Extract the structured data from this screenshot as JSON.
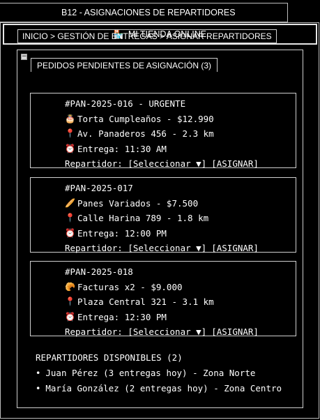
{
  "window": {
    "title": "B12 - ASIGNACIONES DE REPARTIDORES"
  },
  "store": {
    "icon": "store-icon",
    "icon_glyph": "🏪",
    "name": "MI TIENDA ONLINE"
  },
  "breadcrumb": "INICIO > GESTIÓN DE ENTREGAS > ASIGNAR REPARTIDORES",
  "pending": {
    "collapse_glyph": "−",
    "title": "PEDIDOS PENDIENTES DE ASIGNACIÓN (3)",
    "orders": [
      {
        "id_line": "#PAN-2025-016 - URGENTE",
        "item_icon": "🎂",
        "item": "Torta Cumpleaños - $12.990",
        "address_icon": "📍",
        "address": "Av. Panaderos 456 - 2.3 km",
        "time_icon": "⏰",
        "delivery": "Entrega: 11:30 AM",
        "courier_label": "Repartidor:",
        "select_label": "[Seleccionar ▼]",
        "assign_label": "[ASIGNAR]"
      },
      {
        "id_line": "#PAN-2025-017",
        "item_icon": "🥖",
        "item": "Panes Variados - $7.500",
        "address_icon": "📍",
        "address": "Calle Harina 789 - 1.8 km",
        "time_icon": "⏰",
        "delivery": "Entrega: 12:00 PM",
        "courier_label": "Repartidor:",
        "select_label": "[Seleccionar ▼]",
        "assign_label": "[ASIGNAR]"
      },
      {
        "id_line": "#PAN-2025-018",
        "item_icon": "🥐",
        "item": "Facturas x2 - $9.000",
        "address_icon": "📍",
        "address": "Plaza Central 321 - 3.1 km",
        "time_icon": "⏰",
        "delivery": "Entrega: 12:30 PM",
        "courier_label": "Repartidor:",
        "select_label": "[Seleccionar ▼]",
        "assign_label": "[ASIGNAR]"
      }
    ]
  },
  "couriers": {
    "title": "REPARTIDORES DISPONIBLES (2)",
    "bullet": "•",
    "list": [
      "Juan Pérez (3 entregas hoy) - Zona Norte",
      "María González (2 entregas hoy) - Zona Centro"
    ]
  }
}
